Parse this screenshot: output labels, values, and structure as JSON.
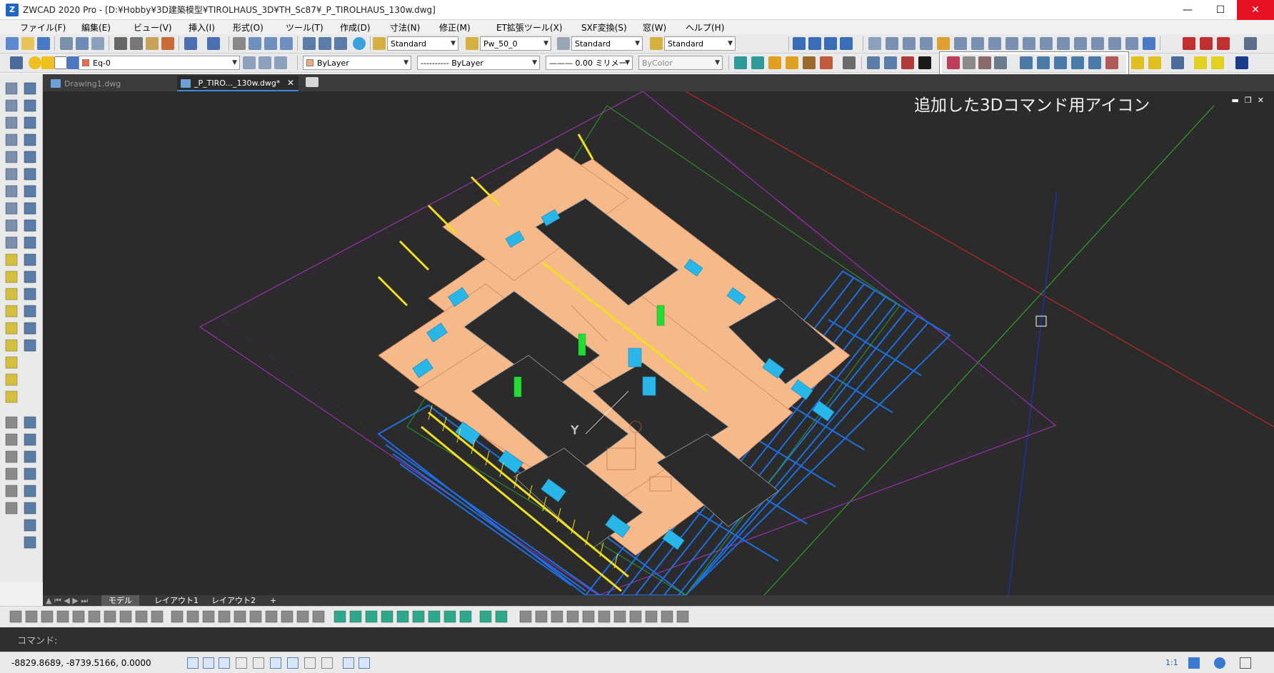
{
  "window": {
    "title": "ZWCAD 2020 Pro - [D:¥Hobby¥3D建築模型¥TIROLHAUS_3D¥TH_Sc87¥_P_TIROLHAUS_130w.dwg]",
    "app_icon_label": "Z",
    "minimize": "—",
    "maximize": "☐",
    "close": "✕"
  },
  "menu": [
    "ファイル(F)",
    "編集(E)",
    "ビュー(V)",
    "挿入(I)",
    "形式(O)",
    "ツール(T)",
    "作成(D)",
    "寸法(N)",
    "修正(M)",
    "ET拡張ツール(X)",
    "SXF変換(S)",
    "窓(W)",
    "ヘルプ(H)"
  ],
  "toolbar": {
    "text_style": "Standard",
    "dim_style": "Pw_50_0",
    "table_style": "Standard",
    "multileader_style": "Standard",
    "layer": "Eq-0",
    "color": "ByLayer",
    "linetype": "---------- ByLayer",
    "lineweight": "——— 0.00 ミリメー",
    "plotstyle": "ByColor"
  },
  "tabs": {
    "doc1": "Drawing1.dwg",
    "doc2": "_P_TIRO..._130w.dwg*",
    "doc2_close": "✕"
  },
  "annotation": "追加した3Dコマンド用アイコン",
  "layout_tabs": [
    "モデル",
    "レイアウト1",
    "レイアウト2",
    "+"
  ],
  "command": {
    "prompt": "コマンド:"
  },
  "status": {
    "coords": "-8829.8689, -8739.5166, 0.0000",
    "scale": "1:1"
  },
  "colors": {
    "canvas_bg": "#2b2b2b",
    "walls": "#f5b98a",
    "windows": "#29b6e8",
    "trim": "#f0e020",
    "deck": "#1f6fe0",
    "boundary": "#9a2fb0",
    "axis_x": "#c0282a",
    "axis_y": "#2da02d",
    "axis_z": "#2030b0"
  }
}
